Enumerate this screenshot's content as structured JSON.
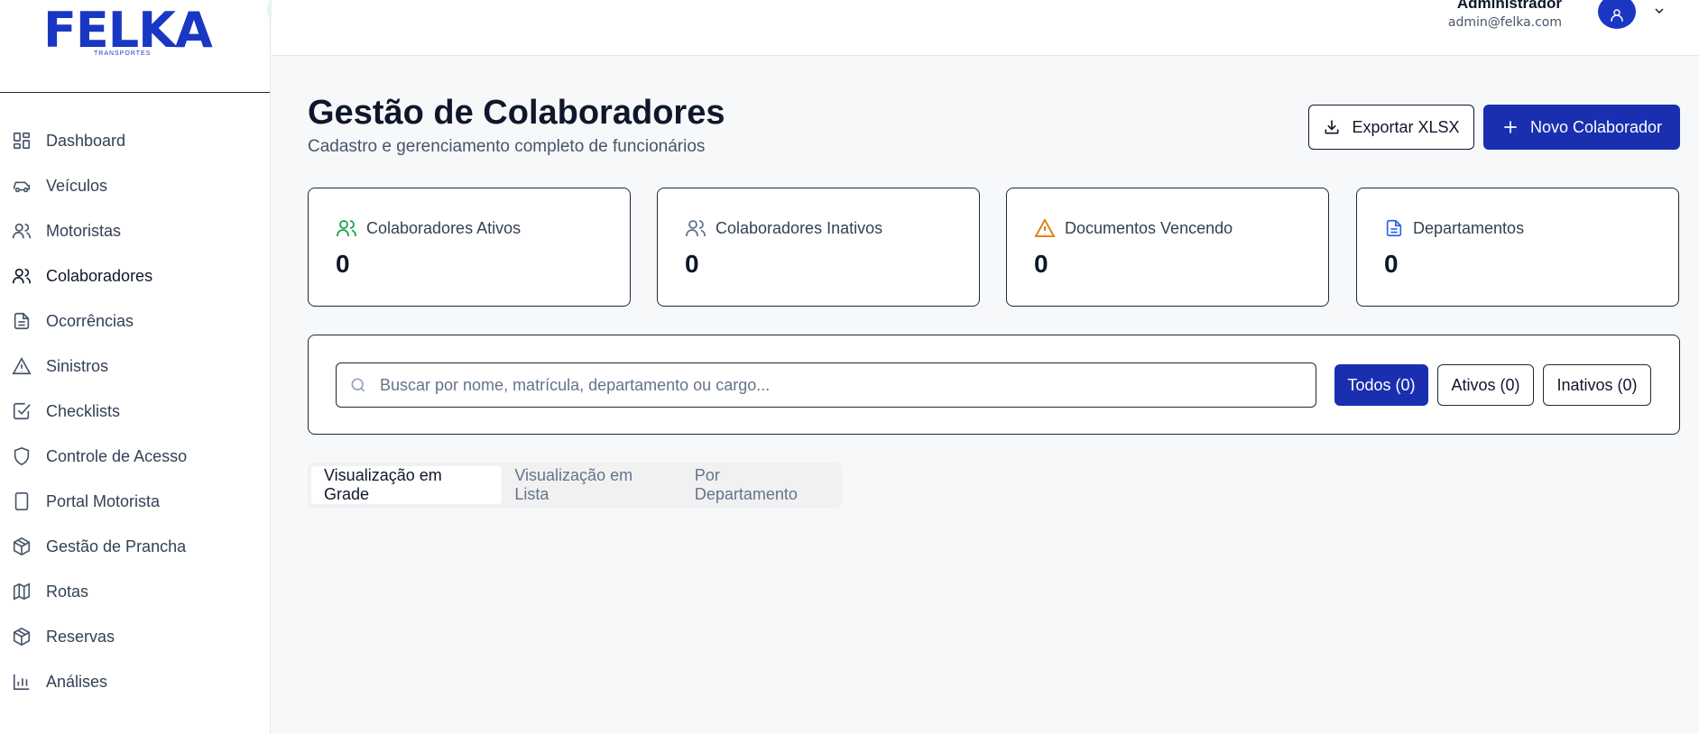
{
  "brand": {
    "name": "FELKA",
    "tagline": "TRANSPORTES"
  },
  "sidebar": {
    "items": [
      {
        "label": "Dashboard",
        "icon": "dashboard-icon"
      },
      {
        "label": "Veículos",
        "icon": "car-icon"
      },
      {
        "label": "Motoristas",
        "icon": "users-icon"
      },
      {
        "label": "Colaboradores",
        "icon": "users-icon",
        "active": true
      },
      {
        "label": "Ocorrências",
        "icon": "file-text-icon"
      },
      {
        "label": "Sinistros",
        "icon": "alert-triangle-icon"
      },
      {
        "label": "Checklists",
        "icon": "check-square-icon"
      },
      {
        "label": "Controle de Acesso",
        "icon": "shield-icon"
      },
      {
        "label": "Portal Motorista",
        "icon": "tablet-icon"
      },
      {
        "label": "Gestão de Prancha",
        "icon": "package-icon"
      },
      {
        "label": "Rotas",
        "icon": "map-icon"
      },
      {
        "label": "Reservas",
        "icon": "package-icon"
      },
      {
        "label": "Análises",
        "icon": "bar-chart-icon"
      }
    ]
  },
  "header": {
    "user_name": "Administrador",
    "user_email": "admin@felka.com"
  },
  "main": {
    "title": "Gestão de Colaboradores",
    "subtitle": "Cadastro e gerenciamento completo de funcionários",
    "export_label": "Exportar XLSX",
    "new_label": "Novo Colaborador",
    "stats": [
      {
        "label": "Colaboradores Ativos",
        "value": "0",
        "icon": "users-icon",
        "color": "#16a34a"
      },
      {
        "label": "Colaboradores Inativos",
        "value": "0",
        "icon": "users-icon",
        "color": "#64748b"
      },
      {
        "label": "Documentos Vencendo",
        "value": "0",
        "icon": "alert-triangle-icon",
        "color": "#d97706"
      },
      {
        "label": "Departamentos",
        "value": "0",
        "icon": "file-text-icon",
        "color": "#2563eb"
      }
    ],
    "search": {
      "placeholder": "Buscar por nome, matrícula, departamento ou cargo..."
    },
    "filters": {
      "all": "Todos (0)",
      "active": "Ativos (0)",
      "inactive": "Inativos (0)"
    },
    "tabs": [
      {
        "label": "Visualização em Grade",
        "active": true
      },
      {
        "label": "Visualização em Lista"
      },
      {
        "label": "Por Departamento"
      }
    ]
  },
  "colors": {
    "primary": "#1a2fb0",
    "brand": "#1a37c4"
  }
}
